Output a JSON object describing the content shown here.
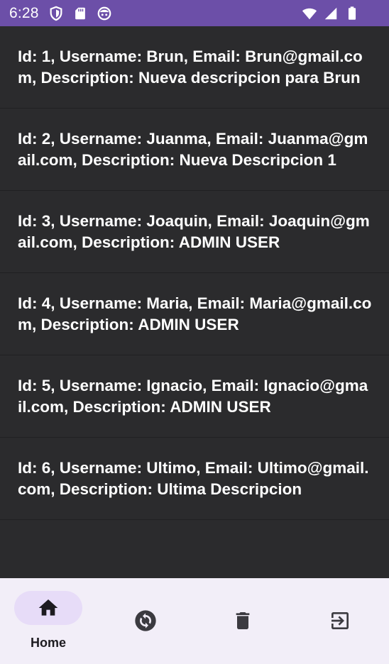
{
  "status_bar": {
    "time": "6:28",
    "left_icons": [
      "shield-icon",
      "sd-card-icon",
      "face-icon"
    ],
    "right_icons": [
      "wifi-icon",
      "signal-icon",
      "battery-icon"
    ],
    "color": "#6c4fa8"
  },
  "users": [
    {
      "text": "Id: 1, Username: Brun, Email: Brun@gmail.com, Description: Nueva descripcion para Brun"
    },
    {
      "text": "Id: 2, Username: Juanma, Email: Juanma@gmail.com, Description: Nueva Descripcion 1"
    },
    {
      "text": "Id: 3, Username: Joaquin, Email: Joaquin@gmail.com, Description: ADMIN USER"
    },
    {
      "text": "Id: 4, Username: Maria, Email: Maria@gmail.com, Description: ADMIN USER"
    },
    {
      "text": "Id: 5, Username: Ignacio, Email: Ignacio@gmail.com, Description: ADMIN USER"
    },
    {
      "text": "Id: 6, Username: Ultimo, Email: Ultimo@gmail.com, Description: Ultima Descripcion"
    }
  ],
  "bottom_nav": {
    "items": [
      {
        "name": "home",
        "label": "Home",
        "icon": "home-icon",
        "selected": true
      },
      {
        "name": "refresh",
        "label": "",
        "icon": "sync-icon",
        "selected": false
      },
      {
        "name": "delete",
        "label": "",
        "icon": "trash-icon",
        "selected": false
      },
      {
        "name": "logout",
        "label": "",
        "icon": "logout-icon",
        "selected": false
      }
    ],
    "background": "#f2eef8",
    "indicator_color": "#e7dcf8"
  }
}
